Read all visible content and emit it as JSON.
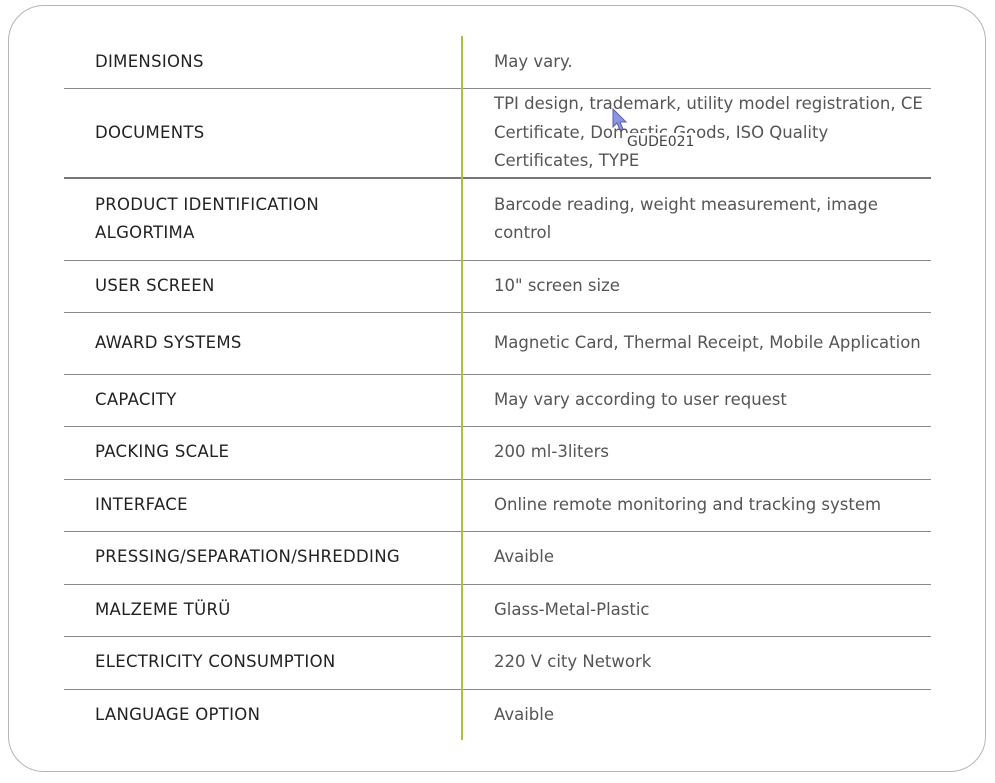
{
  "specs": [
    {
      "label": "DIMENSIONS",
      "value": "May vary."
    },
    {
      "label": "DOCUMENTS",
      "value": "TPI design, trademark, utility model registration, CE Certificate, Domestic Goods, ISO Quality Certificates, TYPE"
    },
    {
      "label": "PRODUCT IDENTIFICATION ALGORTIMA",
      "value": "Barcode reading, weight measurement, image control"
    },
    {
      "label": "USER SCREEN",
      "value": "10\" screen size"
    },
    {
      "label": "AWARD SYSTEMS",
      "value": "Magnetic Card, Thermal Receipt, Mobile Application"
    },
    {
      "label": "CAPACITY",
      "value": "May vary according to user request"
    },
    {
      "label": "PACKING SCALE",
      "value": "200 ml-3liters"
    },
    {
      "label": "INTERFACE",
      "value": "Online remote monitoring and tracking system"
    },
    {
      "label": "PRESSING/SEPARATION/SHREDDING",
      "value": "Avaible"
    },
    {
      "label": "MALZEME TÜRÜ",
      "value": "Glass-Metal-Plastic"
    },
    {
      "label": "ELECTRICITY CONSUMPTION",
      "value": "220 V city Network"
    },
    {
      "label": "LANGUAGE OPTION",
      "value": "Avaible"
    }
  ],
  "tooltip": "GUDE021"
}
